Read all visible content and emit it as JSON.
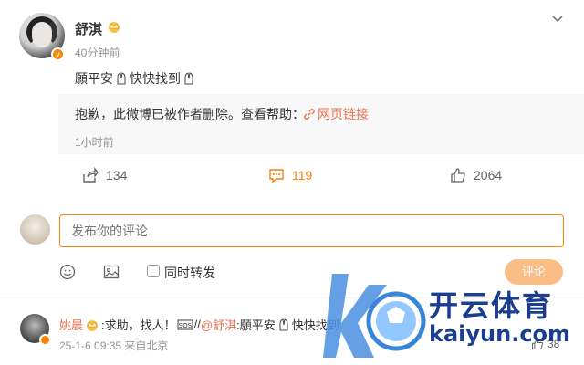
{
  "post": {
    "user_name": "舒淇",
    "time_ago": "40分钟前",
    "text_part1": "願平安",
    "text_part2": " 快快找到",
    "v_badge": "v"
  },
  "repost": {
    "deleted_text": "抱歉，此微博已被作者删除。查看帮助：",
    "help_link": "网页链接",
    "time": "1小时前"
  },
  "actions": {
    "share_count": "134",
    "comment_count": "119",
    "like_count": "2064"
  },
  "comment_box": {
    "placeholder": "发布你的评论",
    "repost_label": "同时转发",
    "submit_label": "评论"
  },
  "comment": {
    "user": "姚晨",
    "text_a": ":求助，找人！",
    "text_b": "//",
    "mention": "@舒淇",
    "text_c": ":願平安",
    "text_d": " 快快找到",
    "time": "25-1-6 09:35 来自北京",
    "like_count": "38"
  },
  "watermark": {
    "name": "开云体育",
    "url": "kaiyun.com"
  },
  "colors": {
    "accent": "#ff8200",
    "link": "#eb7350",
    "muted": "#939393"
  }
}
